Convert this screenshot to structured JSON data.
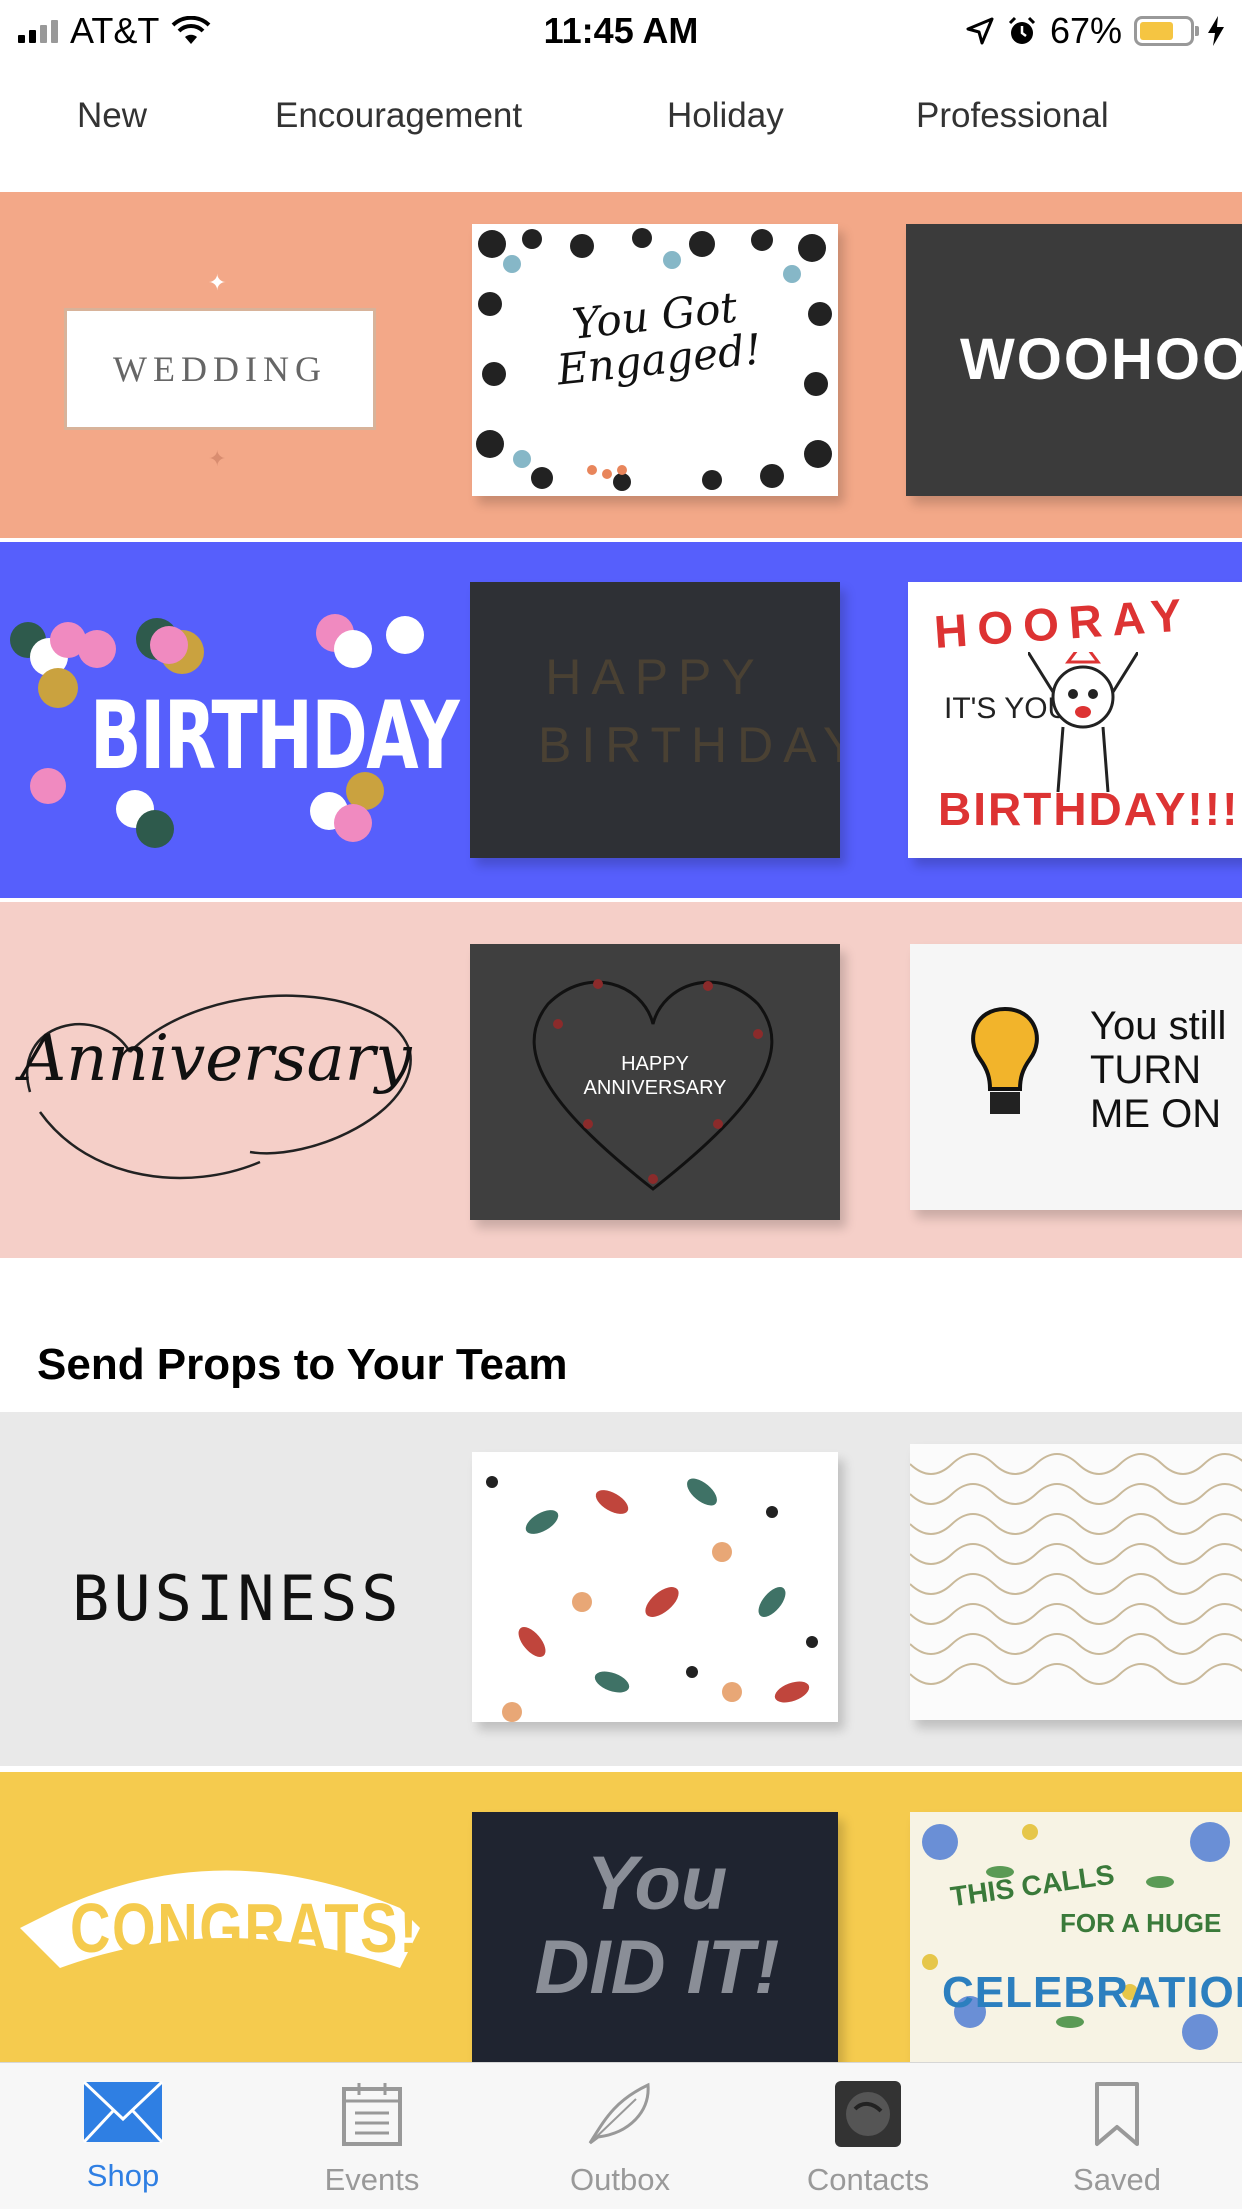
{
  "status_bar": {
    "carrier": "AT&T",
    "time": "11:45 AM",
    "battery": "67%",
    "battery_level": 0.67
  },
  "category_tabs": [
    "New",
    "Encouragement",
    "Holiday",
    "Professional"
  ],
  "banners": {
    "wedding": {
      "label": "WEDDING",
      "card1_text": "You Got Engaged!",
      "card2_text": "WOOHOO!",
      "color": "#f3a888"
    },
    "birthday": {
      "label": "BIRTHDAY",
      "card1_text": "HAPPY BIRTHDAY",
      "card2_top": "HOORAY",
      "card2_mid": "IT'S YOUR",
      "card2_bottom": "BIRTHDAY!!!",
      "color": "#565ffc"
    },
    "anniversary": {
      "label": "Anniversary",
      "card1_text": "HAPPY ANNIVERSARY",
      "card2_text": "You still TURN ME ON",
      "color": "#f5cfc8"
    }
  },
  "section": {
    "title": "Send Props to Your Team"
  },
  "team_banners": {
    "business": {
      "label": "BUSINESS",
      "color": "#e9e9e9"
    },
    "congrats": {
      "label": "CONGRATS!",
      "card1_text": "You DID IT!",
      "card2_top": "THIS CALLS",
      "card2_mid": "FOR A HUGE",
      "card2_bottom": "CELEBRATION",
      "color": "#f5cb4e"
    }
  },
  "tabbar": [
    {
      "label": "Shop",
      "icon": "envelope-icon",
      "active": true
    },
    {
      "label": "Events",
      "icon": "calendar-icon",
      "active": false
    },
    {
      "label": "Outbox",
      "icon": "feather-icon",
      "active": false
    },
    {
      "label": "Contacts",
      "icon": "contact-avatar-icon",
      "active": false
    },
    {
      "label": "Saved",
      "icon": "bookmark-icon",
      "active": false
    }
  ],
  "colors": {
    "accent": "#2f7fe3",
    "inactive": "#999999"
  }
}
